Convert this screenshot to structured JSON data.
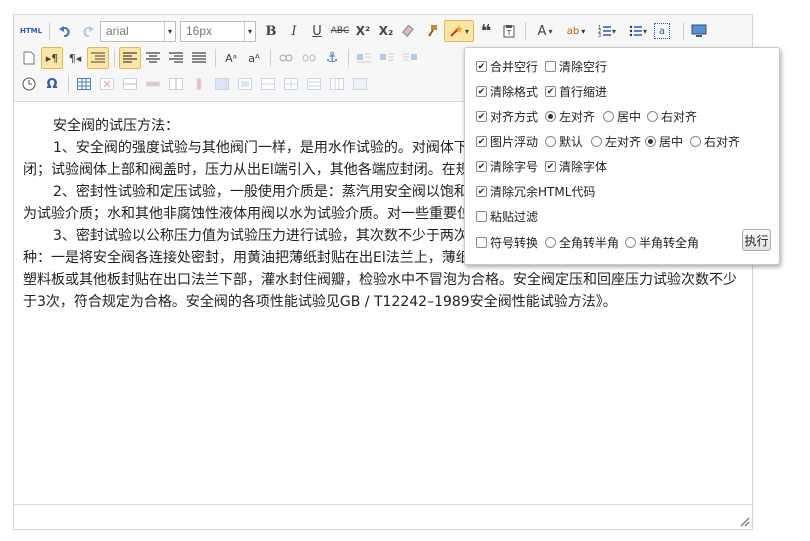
{
  "toolbar": {
    "html_label": "HTML",
    "font_family": "arial",
    "font_size": "16px"
  },
  "content": {
    "paragraphs": [
      "安全阀的试压方法：",
      "1、安全阀的强度试验与其他阀门一样，是用水作试验的。对阀体下部进行试验时，压力从进口端引入，密封面封闭；试验阀体上部和阀盖时，压力从出El端引入，其他各端应封闭。在规定的时间内壳体外表无渗漏现象为合格。",
      "2、密封性试验和定压试验，一般使用介质是：蒸汽用安全阀以饱和蒸汽为试验介质；氨用或其他气体用阀以空气为试验介质；水和其他非腐蚀性液体用阀以水为试验介质。对一些重要位置的安全阀，常用氮气为试验介质。",
      "3、密封试验以公称压力值为试验压力进行试验，其次数不少于两次，在规定时间内无渗漏为合格。验漏方法有两种：一是将安全阀各连接处密封，用黄油把薄纸封贴在出El法兰上，薄纸鼓起为漏，不鼓起为合格；二是用黄油把薄塑料板或其他板封贴在出口法兰下部，灌水封住阀瓣，检验水中不冒泡为合格。安全阀定压和回座压力试验次数不少于3次，符合规定为合格。安全阀的各项性能试验见GB / T12242–1989安全阀性能试验方法》。"
    ]
  },
  "popup": {
    "merge_empty_lines": "合并空行",
    "clear_empty_lines": "清除空行",
    "clear_format": "清除格式",
    "first_line_indent": "首行缩进",
    "align_mode": "对齐方式",
    "align_left": "左对齐",
    "align_center": "居中",
    "align_right": "右对齐",
    "image_float": "图片浮动",
    "float_default": "默认",
    "float_left": "左对齐",
    "float_center": "居中",
    "float_right": "右对齐",
    "clear_font_size": "清除字号",
    "clear_font": "清除字体",
    "clear_redundant_html": "清除冗余HTML代码",
    "paste_filter": "粘贴过滤",
    "symbol_convert": "符号转换",
    "full_to_half": "全角转半角",
    "half_to_full": "半角转全角",
    "execute_label": "执行"
  }
}
